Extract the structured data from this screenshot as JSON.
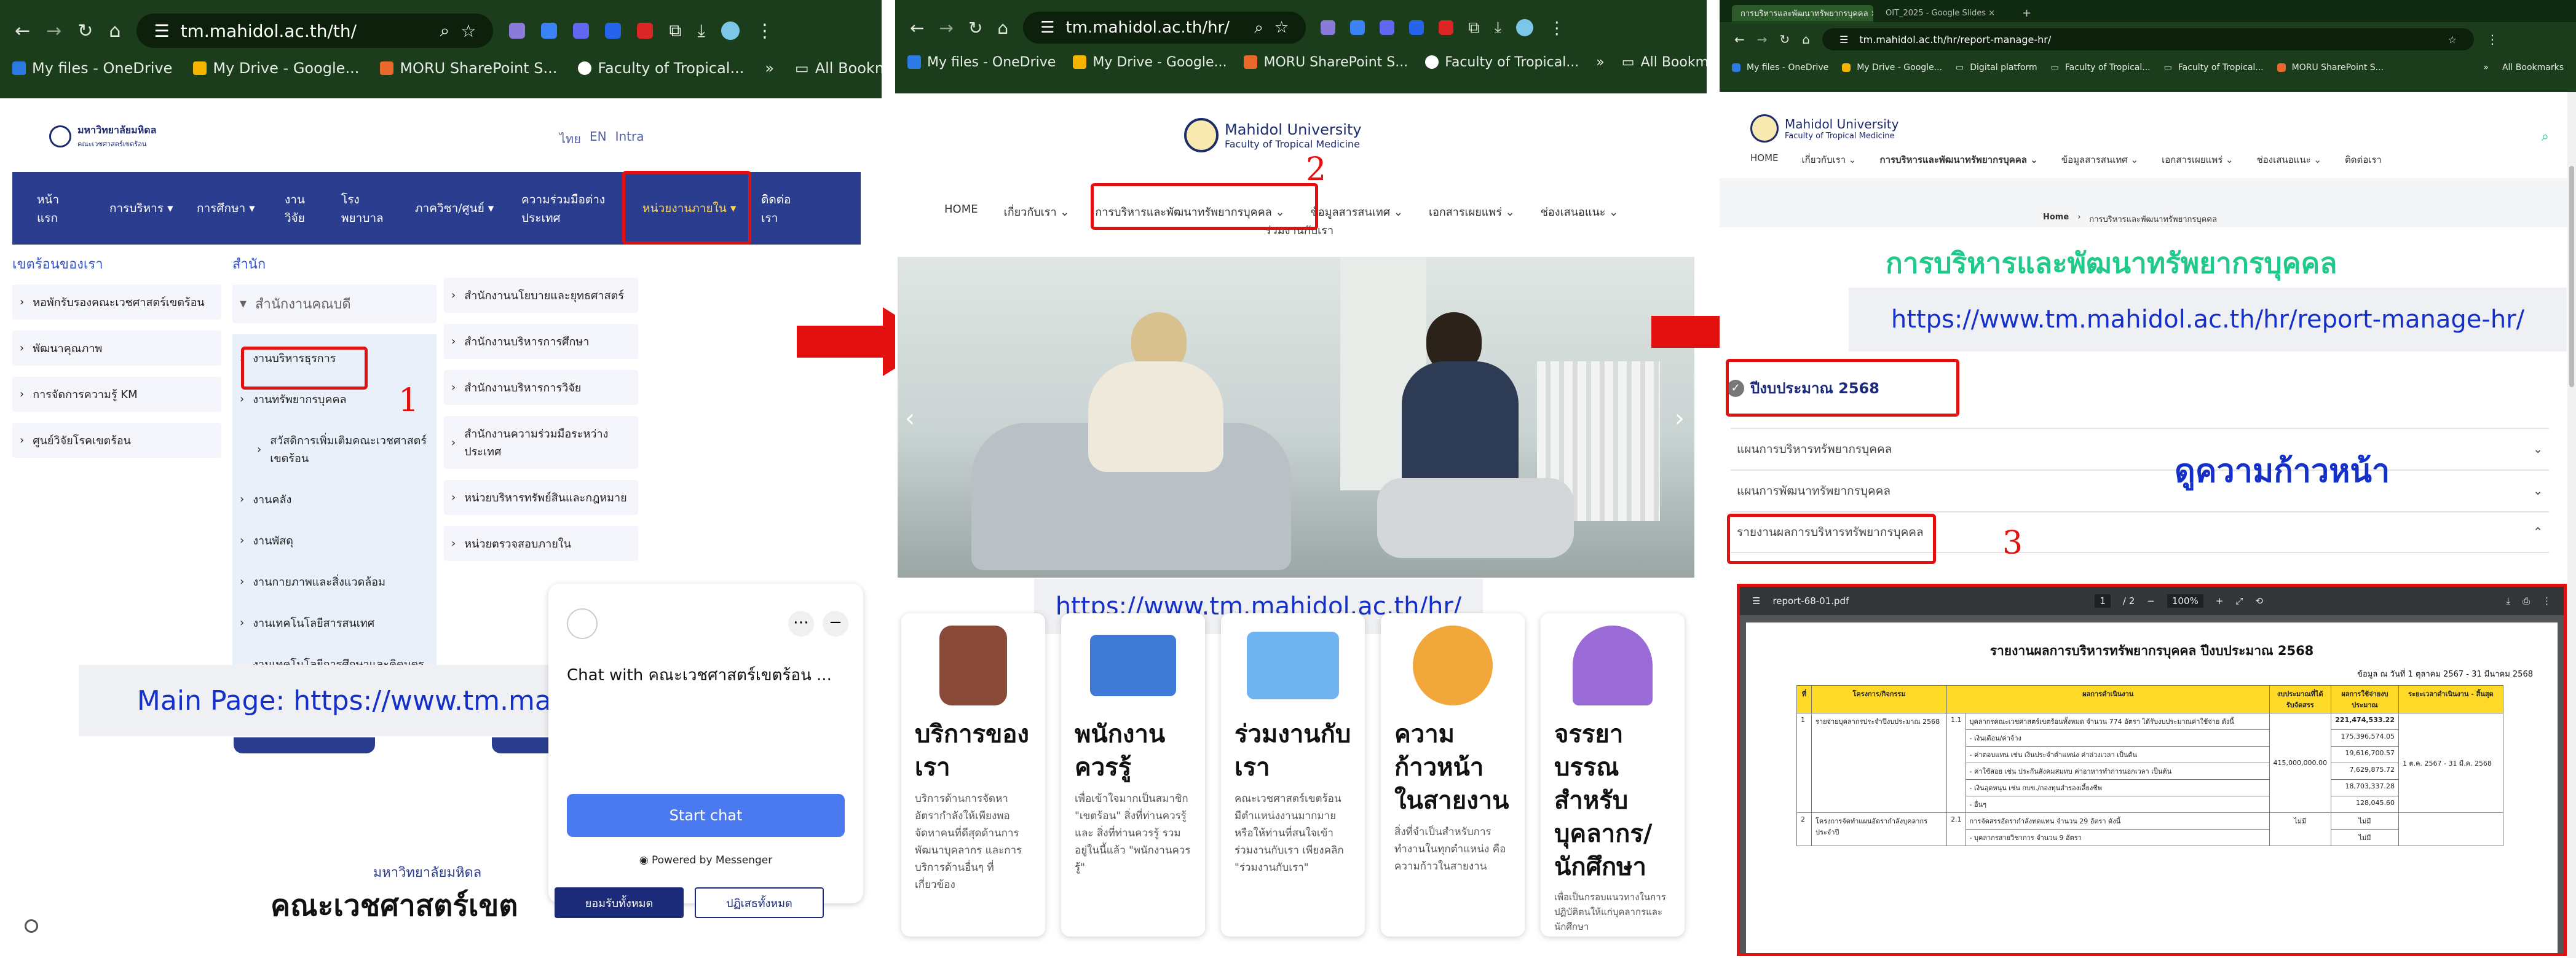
{
  "panel1": {
    "address": "tm.mahidol.ac.th/th/",
    "bookmarks": [
      "My files - OneDrive",
      "My Drive - Google...",
      "MORU SharePoint S...",
      "Faculty of Tropical..."
    ],
    "all_bookmarks": "All Bookmarks",
    "logo_th": "มหาวิทยาลัยมหิดล",
    "logo_sub": "คณะเวชศาสตร์เขตร้อน",
    "lang": {
      "th": "ไทย",
      "en": "EN",
      "intra": "Intra"
    },
    "nav": [
      "หน้าแรก",
      "การบริหาร",
      "การศึกษา",
      "งานวิจัย",
      "โรงพยาบาล",
      "ภาควิชา/ศูนย์",
      "ความร่วมมือต่างประเทศ",
      "หน่วยงานภายใน",
      "ติดต่อเรา"
    ],
    "dd_left_heading": "เขตร้อนของเรา",
    "dd_left": [
      "หอพักรับรองคณะเวชศาสตร์เขตร้อน",
      "พัฒนาคุณภาพ",
      "การจัดการความรู้ KM",
      "ศูนย์วิจัยโรคเขตร้อน"
    ],
    "dd_mid_heading": "สำนัก",
    "dd_mid_sub": "สำนักงานคณบดี",
    "dd_mid": [
      "งานบริหารธุรการ",
      "งานทรัพยากรบุคคล",
      "สวัสดิการเพิ่มเติมคณะเวชศาสตร์เขตร้อน",
      "งานคลัง",
      "งานพัสดุ",
      "งานกายภาพและสิ่งแวดล้อม",
      "งานเทคโนโลยีสารสนเทศ",
      "งานเทคโนโลยีการศึกษาและคิดมูดรรม"
    ],
    "dd_right": [
      "สำนักงานนโยบายและยุทธศาสตร์",
      "สำนักงานบริหารการศึกษา",
      "สำนักงานบริหารการวิจัย",
      "สำนักงานความร่วมมือระหว่างประเทศ",
      "หน่วยบริหารทรัพย์สินและกฎหมาย",
      "หน่วยตรวจสอบภายใน"
    ],
    "step": "1",
    "chat_title": "Chat with คณะเวชศาสตร์เขตร้อน ...",
    "start_chat": "Start chat",
    "powered": "Powered by Messenger",
    "footer_heading": "มหาวิทยาลัยมหิดล",
    "footer_big": "คณะเวชศาสตร์เขต",
    "accept_btn": "ยอมรับทั้งหมด",
    "reject_btn": "ปฏิเสธทั้งหมด",
    "callout": "Main Page: https://www.tm.mahidol.ac.th/th/"
  },
  "panel2": {
    "address": "tm.mahidol.ac.th/hr/",
    "bookmarks": [
      "My files - OneDrive",
      "My Drive - Google...",
      "MORU SharePoint S...",
      "Faculty of Tropical..."
    ],
    "all_bookmarks": "All Bookmarks",
    "uni": "Mahidol University",
    "fac": "Faculty of Tropical Medicine",
    "nav": [
      "HOME",
      "เกี่ยวกับเรา",
      "การบริหารและพัฒนาทรัพยากรบุคคล",
      "ข้อมูลสารสนเทศ",
      "เอกสารเผยแพร่",
      "ช่องเสนอแนะ"
    ],
    "nav_extra": "ร่วมงานกับเรา",
    "step": "2",
    "callout": "https://www.tm.mahidol.ac.th/hr/",
    "cards": [
      {
        "title": "บริการของเรา",
        "text": "บริการด้านการจัดหา อัตรากำลังให้เพียงพอ จัดหาคนที่ดีสุดด้านการพัฒนาบุคลากร และการบริการด้านอื่นๆ ที่เกี่ยวข้อง"
      },
      {
        "title": "พนักงานควรรู้",
        "text": "เพื่อเข้าใจมากเป็นสมาชิก \"เขตร้อน\" สิ่งที่ท่านควรรู้ และ สิ่งที่ท่านควรรู้ รวมอยู่ในนี้แล้ว \"พนักงานควรรู้\""
      },
      {
        "title": "ร่วมงานกับเรา",
        "text": "คณะเวชศาสตร์เขตร้อน มีตำแหน่งงานมากมาย หรือให้ท่านที่สนใจเข้าร่วมงานกับเรา เพียงคลิก \"ร่วมงานกับเรา\""
      },
      {
        "title": "ความก้าวหน้าในสายงาน",
        "text": "สิ่งที่จำเป็นสำหรับการทำงานในทุกตำแหน่ง คือความก้าวในสายงาน"
      },
      {
        "title": "จรรยาบรรณสำหรับบุคลากร/นักศึกษา",
        "text": "เพื่อเป็นกรอบแนวทางในการปฏิบัติตนให้แก่บุคลากรและนักศึกษา"
      }
    ]
  },
  "panel3": {
    "tab1": "การบริหารและพัฒนาทรัพยากรบุคคล",
    "tab2": "OIT_2025 - Google Slides",
    "address": "tm.mahidol.ac.th/hr/report-manage-hr/",
    "bookmarks": [
      "My files - OneDrive",
      "My Drive - Google...",
      "Digital platform",
      "Faculty of Tropical...",
      "Faculty of Tropical...",
      "MORU SharePoint S..."
    ],
    "all_bookmarks": "All Bookmarks",
    "uni": "Mahidol University",
    "fac": "Faculty of Tropical Medicine",
    "nav": [
      "HOME",
      "เกี่ยวกับเรา",
      "การบริหารและพัฒนาทรัพยากรบุคคล",
      "ข้อมูลสารสนเทศ",
      "เอกสารเผยแพร่",
      "ช่องเสนอแนะ",
      "ติดต่อเรา"
    ],
    "breadcrumb_home": "Home",
    "breadcrumb_page": "การบริหารและพัฒนาทรัพยากรบุคคล",
    "title": "การบริหารและพัฒนาทรัพยากรบุคคล",
    "url_callout": "https://www.tm.mahidol.ac.th/hr/report-manage-hr/",
    "fiscal": "ปีงบประมาณ 2568",
    "acc": [
      "แผนการบริหารทรัพยากรบุคคล",
      "แผนการพัฒนาทรัพยากรบุคคล",
      "รายงานผลการบริหารทรัพยากรบุคคล"
    ],
    "progress_note": "ดูความก้าวหน้า",
    "step": "3",
    "pdf_name": "report-68-01.pdf",
    "pdf_page": "1",
    "pdf_pages": "/ 2",
    "pdf_zoom": "100%",
    "report_title": "รายงานผลการบริหารทรัพยากรบุคคล ปีงบประมาณ 2568",
    "report_date": "ข้อมูล ณ วันที่ 1 ตุลาคม 2567 - 31 มีนาคม 2568",
    "th": [
      "ที่",
      "โครงการ/กิจกรรม",
      "ผลการดำเนินงาน",
      "งบประมาณที่ได้รับจัดสรร",
      "ผลการใช้จ่ายงบประมาณ",
      "ระยะเวลาดำเนินงาน - สิ้นสุด"
    ],
    "rows": [
      {
        "no": "1",
        "name": "รายจ่ายบุคลากรประจำปีงบประมาณ 2568",
        "sub": "1.1",
        "lines": [
          [
            "บุคลากรคณะเวชศาสตร์เขตร้อนทั้งหมด จำนวน 774 อัตรา ได้รับงบประมาณค่าใช้จ่าย ดังนี้",
            "221,474,533.22"
          ],
          [
            "- เงินเดือน/ค่าจ้าง",
            "175,396,574.05"
          ],
          [
            "- ค่าตอบแทน เช่น เงินประจำตำแหน่ง ค่าล่วงเวลา เป็นต้น",
            "19,616,700.57"
          ],
          [
            "- ค่าใช้สอย เช่น ประกันสังคมสมทบ ค่าอาหารทำการนอกเวลา เป็นต้น",
            "7,629,875.72"
          ],
          [
            "- เงินอุดหนุน เช่น กบข./กองทุนสำรองเลี้ยงชีพ",
            "18,703,337.28"
          ],
          [
            "- อื่นๆ",
            "128,045.60"
          ]
        ],
        "budget": "415,000,000.00",
        "period": "1 ต.ค. 2567 - 31 มี.ค. 2568"
      },
      {
        "no": "2",
        "name": "โครงการจัดทำแผนอัตรากำลังบุคลากรประจำปี",
        "sub": "2.1",
        "lines": [
          [
            "การจัดสรรอัตรากำลังทดแทน จำนวน 29 อัตรา ดังนี้",
            "ไม่มี"
          ],
          [
            "- บุคลากรสายวิชาการ จำนวน 9 อัตรา",
            "ไม่มี"
          ]
        ],
        "budget": "ไม่มี",
        "period": ""
      }
    ]
  },
  "colors": {
    "accent_red": "#e31010",
    "callout_blue": "#1530c8",
    "nav_blue": "#2b3d8e",
    "green_title": "#21c98b",
    "report_yellow": "#ffd928"
  }
}
